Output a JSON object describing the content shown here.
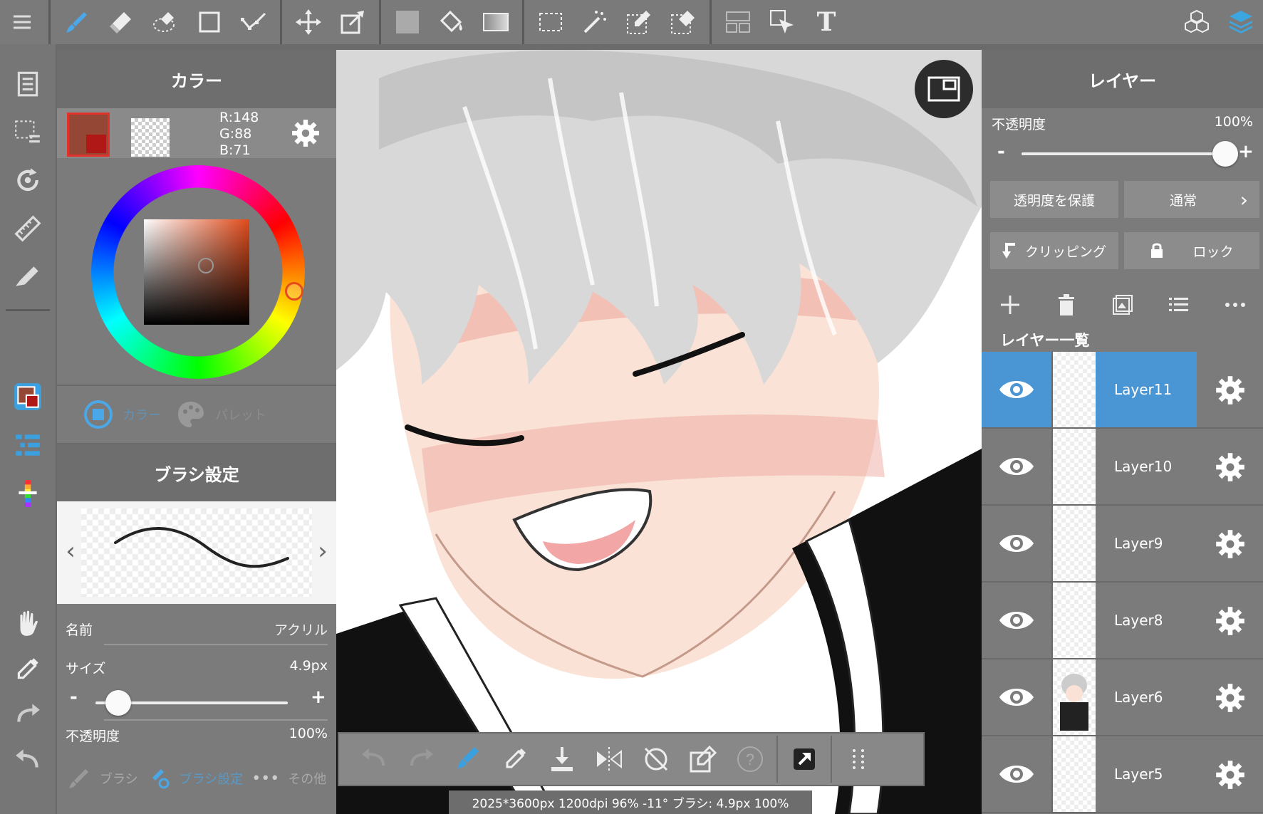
{
  "color_panel": {
    "title": "カラー",
    "rgb": {
      "r": "R:148",
      "g": "G:88",
      "b": "B:71"
    },
    "main_color": "#944735",
    "tabs": {
      "color": "カラー",
      "palette": "パレット"
    }
  },
  "brush_panel": {
    "title": "ブラシ設定",
    "name_label": "名前",
    "name_value": "アクリル",
    "size_label": "サイズ",
    "size_value": "4.9px",
    "opacity_label": "不透明度",
    "opacity_value": "100%",
    "minus": "-",
    "plus": "+",
    "tabs": {
      "brush": "ブラシ",
      "brush_settings": "ブラシ設定",
      "more_dots": "•••",
      "other": "その他"
    }
  },
  "layer_panel": {
    "title": "レイヤー",
    "opacity_label": "不透明度",
    "opacity_value": "100%",
    "minus": "-",
    "plus": "+",
    "protect_alpha": "透明度を保護",
    "blend_mode": "通常",
    "clipping": "クリッピング",
    "lock": "ロック",
    "list_title": "レイヤー一覧",
    "layers": [
      {
        "name": "Layer11"
      },
      {
        "name": "Layer10"
      },
      {
        "name": "Layer9"
      },
      {
        "name": "Layer8"
      },
      {
        "name": "Layer6"
      },
      {
        "name": "Layer5"
      }
    ],
    "accent": "#4a95d4"
  },
  "top_toolbar": {
    "text_tool": "T"
  },
  "status": {
    "text": "2025*3600px 1200dpi 96% -11° ブラシ: 4.9px 100%"
  }
}
